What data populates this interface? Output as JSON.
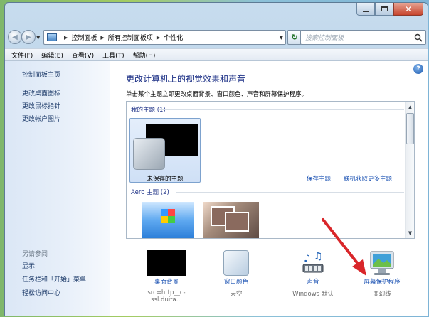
{
  "address": {
    "crumbs": [
      "控制面板",
      "所有控制面板项",
      "个性化"
    ],
    "search_placeholder": "搜索控制面板"
  },
  "menu": [
    "文件(F)",
    "编辑(E)",
    "查看(V)",
    "工具(T)",
    "帮助(H)"
  ],
  "sidebar": {
    "home": "控制面板主页",
    "links": [
      "更改桌面图标",
      "更改鼠标指针",
      "更改帐户图片"
    ],
    "see_also_heading": "另请参阅",
    "see_also": [
      "显示",
      "任务栏和「开始」菜单",
      "轻松访问中心"
    ]
  },
  "main": {
    "title": "更改计算机上的视觉效果和声音",
    "subtitle": "单击某个主题立即更改桌面背景、窗口颜色、声音和屏幕保护程序。",
    "my_themes_heading": "我的主题 (1)",
    "unsaved_theme": "未保存的主题",
    "save_theme": "保存主题",
    "get_more": "联机获取更多主题",
    "aero_heading": "Aero 主题 (2)"
  },
  "bottom": [
    {
      "link": "桌面背景",
      "sub": "src=http__c-ssl.duita..."
    },
    {
      "link": "窗口颜色",
      "sub": "天空"
    },
    {
      "link": "声音",
      "sub": "Windows 默认"
    },
    {
      "link": "屏幕保护程序",
      "sub": "变幻线"
    }
  ],
  "colors": {
    "link": "#1b52b3",
    "title": "#1e3287",
    "annotation_arrow": "#d9262a"
  }
}
